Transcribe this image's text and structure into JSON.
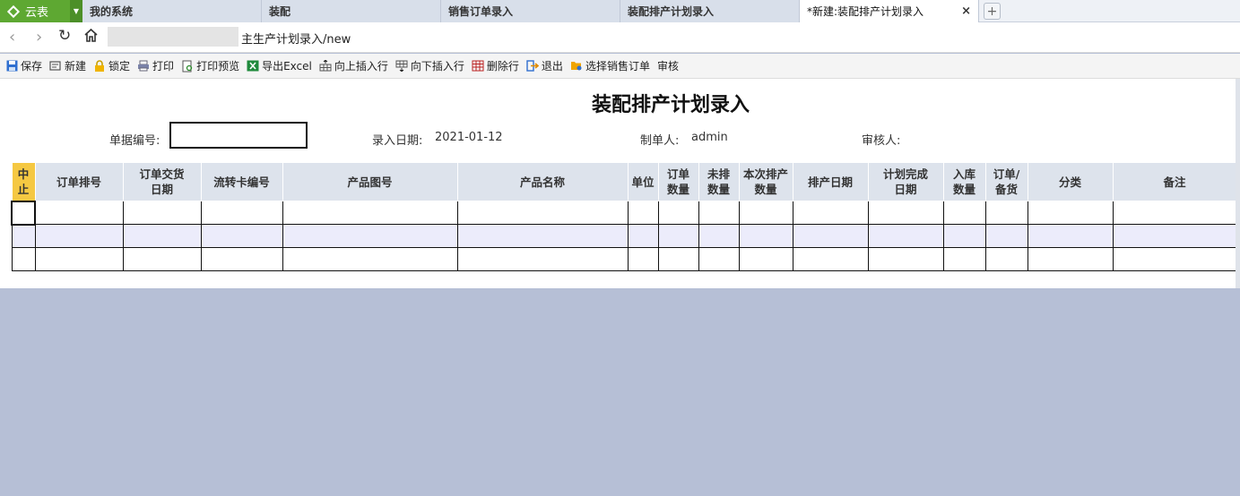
{
  "app": {
    "name": "云表"
  },
  "tabs": [
    {
      "label": "我的系统"
    },
    {
      "label": "装配"
    },
    {
      "label": "销售订单录入"
    },
    {
      "label": "装配排产计划录入"
    },
    {
      "label": "*新建:装配排产计划录入",
      "active": true
    }
  ],
  "address": {
    "url_tail": "主生产计划录入/new"
  },
  "toolbar": [
    {
      "label": "保存",
      "icon": "save-icon"
    },
    {
      "label": "新建",
      "icon": "new-icon"
    },
    {
      "label": "锁定",
      "icon": "lock-icon"
    },
    {
      "label": "打印",
      "icon": "print-icon"
    },
    {
      "label": "打印预览",
      "icon": "print-preview-icon"
    },
    {
      "label": "导出Excel",
      "icon": "excel-icon"
    },
    {
      "label": "向上插入行",
      "icon": "insert-above-icon"
    },
    {
      "label": "向下插入行",
      "icon": "insert-below-icon"
    },
    {
      "label": "删除行",
      "icon": "delete-row-icon"
    },
    {
      "label": "退出",
      "icon": "exit-icon"
    },
    {
      "label": "选择销售订单",
      "icon": "select-order-icon"
    },
    {
      "label": "审核",
      "icon": ""
    }
  ],
  "form": {
    "title": "装配排产计划录入",
    "doc_no_label": "单据编号:",
    "doc_no_value": "",
    "entry_date_label": "录入日期:",
    "entry_date_value": "2021-01-12",
    "creator_label": "制单人:",
    "creator_value": "admin",
    "reviewer_label": "审核人:",
    "reviewer_value": ""
  },
  "grid": {
    "columns": [
      {
        "label": "中\n止"
      },
      {
        "label": "订单排号"
      },
      {
        "label": "订单交货\n日期"
      },
      {
        "label": "流转卡编号"
      },
      {
        "label": "产品图号"
      },
      {
        "label": "产品名称"
      },
      {
        "label": "单位"
      },
      {
        "label": "订单\n数量"
      },
      {
        "label": "未排\n数量"
      },
      {
        "label": "本次排产\n数量"
      },
      {
        "label": "排产日期"
      },
      {
        "label": "计划完成\n日期"
      },
      {
        "label": "入库\n数量"
      },
      {
        "label": "订单/\n备货"
      },
      {
        "label": "分类"
      },
      {
        "label": "备注"
      }
    ],
    "row_count": 3
  },
  "colors": {
    "logo_green": "#5ea832",
    "stop_header": "#f5c842",
    "workspace_bg": "#b6bfd6"
  }
}
